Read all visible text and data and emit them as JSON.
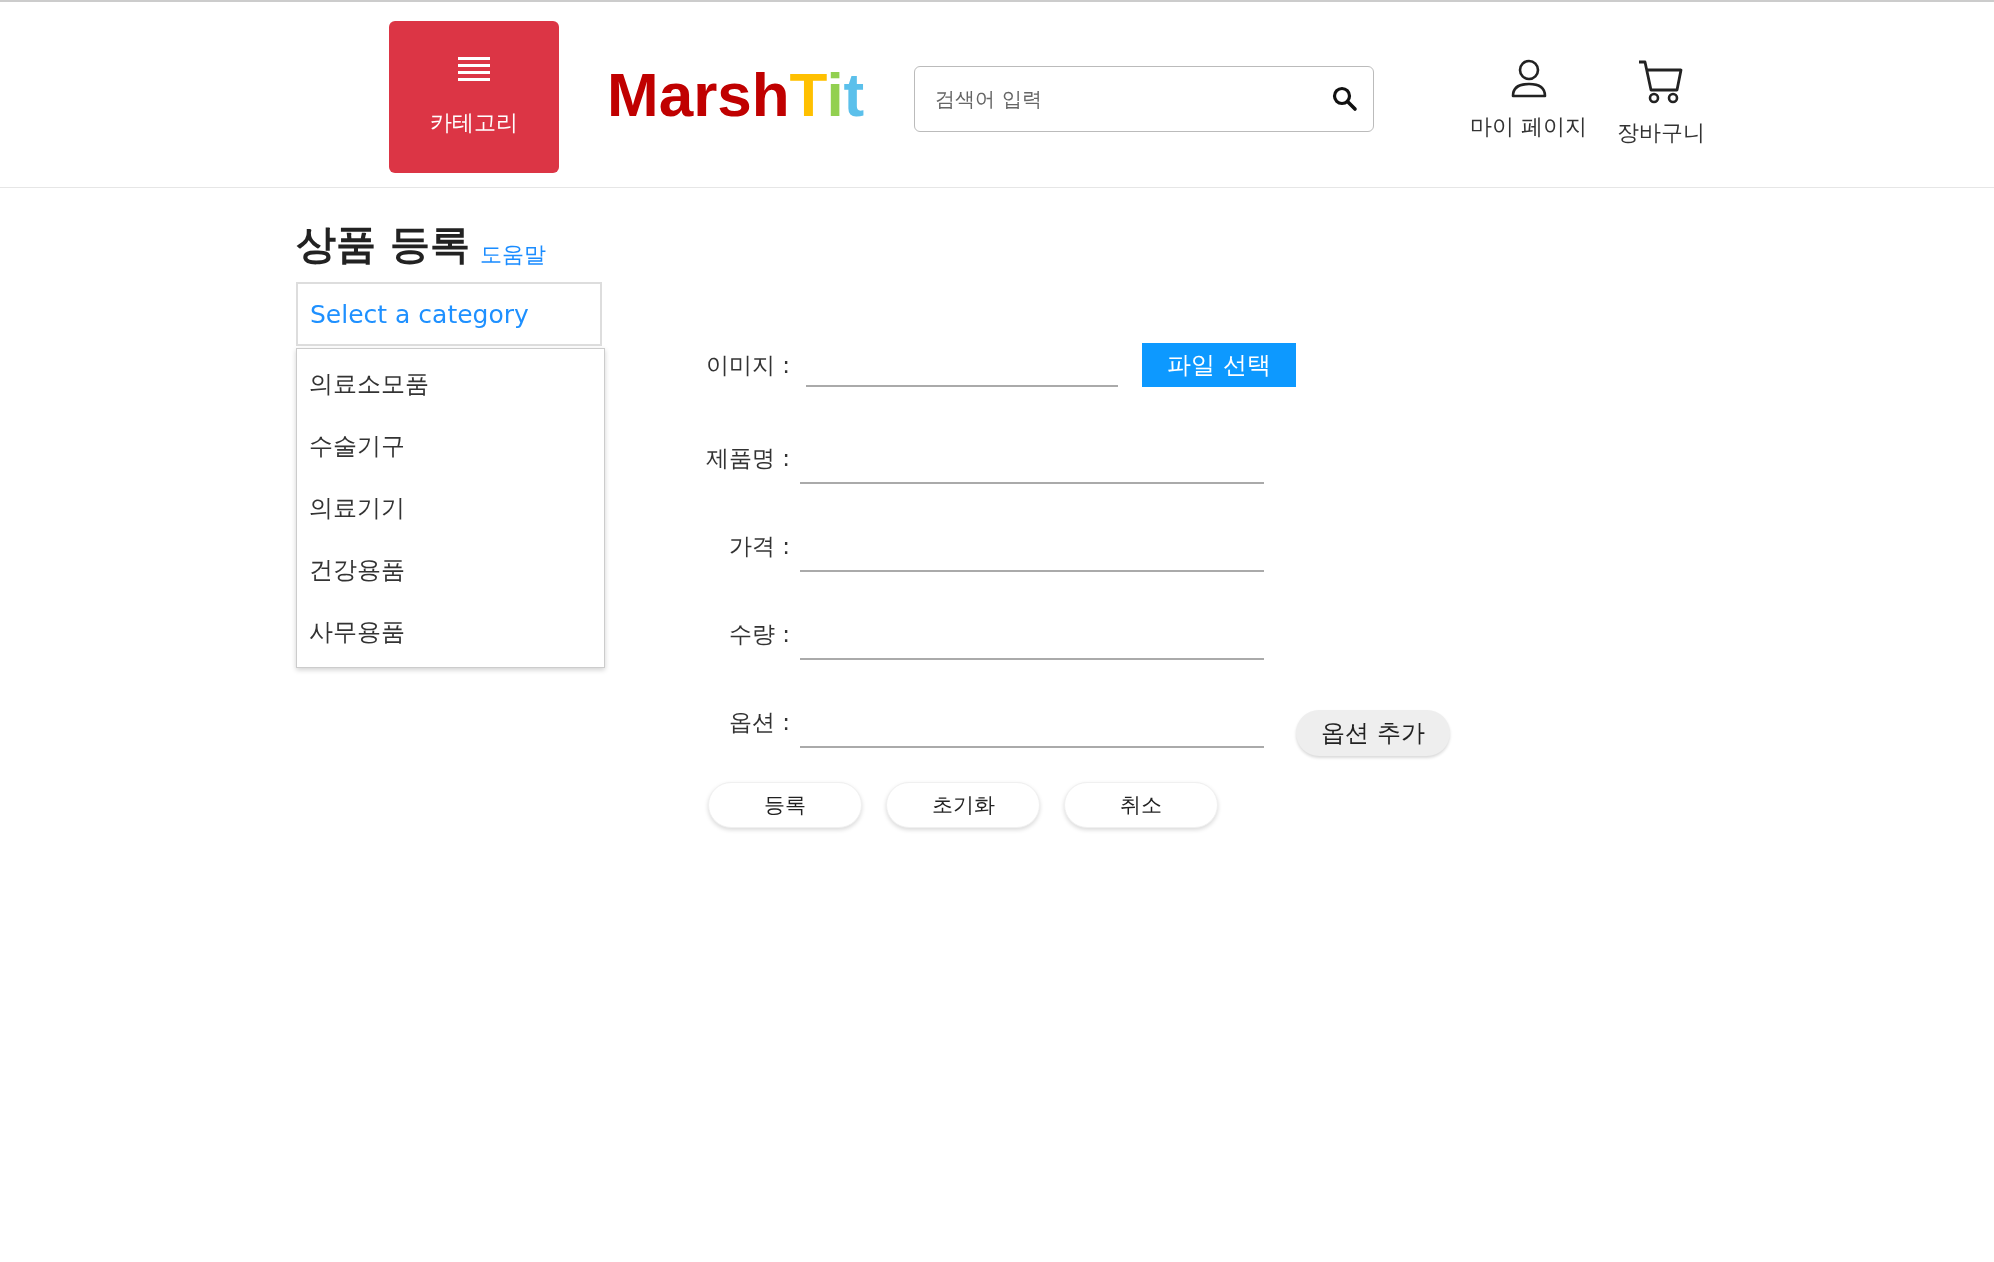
{
  "header": {
    "category_button": "카테고리",
    "logo": [
      {
        "text": "Marsh",
        "color": "#c00000"
      },
      {
        "text": "T",
        "color": "#ffc000"
      },
      {
        "text": "i",
        "color": "#92d050"
      },
      {
        "text": "t",
        "color": "#5bc0eb"
      }
    ],
    "search": {
      "placeholder": "검색어 입력"
    },
    "links": [
      {
        "kind": "user",
        "label": "마이 페이지"
      },
      {
        "kind": "cart",
        "label": "장바구니"
      }
    ]
  },
  "page": {
    "title": "상품 등록",
    "help_link": "도움말"
  },
  "category_select": {
    "value": "Select a category",
    "options": [
      "의료소모품",
      "수술기구",
      "의료기기",
      "건강용품",
      "사무용품"
    ]
  },
  "form": {
    "fields": [
      {
        "kind": "file",
        "label": "이미지 :",
        "button": "파일 선택"
      },
      {
        "kind": "text",
        "label": "제품명 :"
      },
      {
        "kind": "text",
        "label": "가격 :"
      },
      {
        "kind": "text",
        "label": "수량 :"
      },
      {
        "kind": "option",
        "label": "옵션 :",
        "button": "옵션 추가"
      }
    ],
    "actions": [
      "등록",
      "초기화",
      "취소"
    ]
  }
}
